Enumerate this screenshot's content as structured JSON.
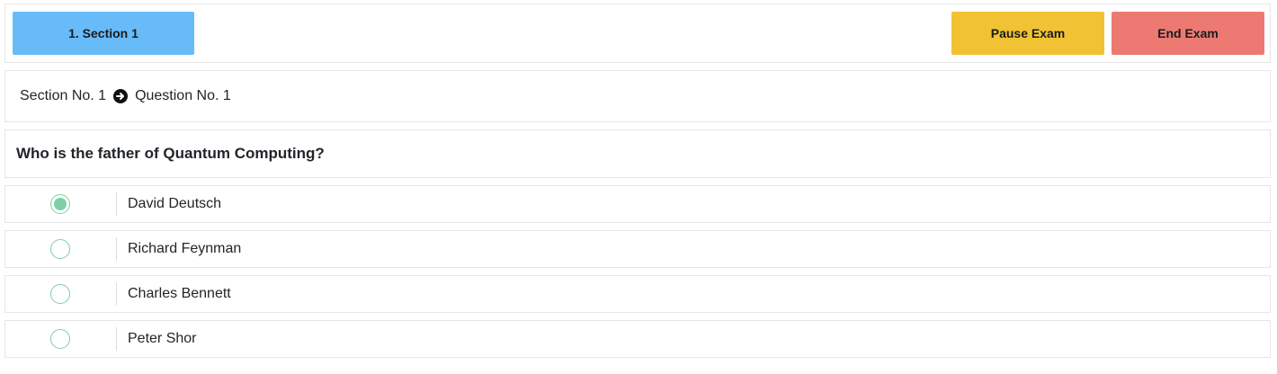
{
  "toolbar": {
    "section_button": "1. Section 1",
    "pause_button": "Pause Exam",
    "end_button": "End Exam",
    "colors": {
      "section": "#67bbf9",
      "pause": "#f1c233",
      "end": "#ec7a73"
    }
  },
  "breadcrumb": {
    "section": "Section No. 1",
    "separator_icon": "arrow-circle-right-icon",
    "question": "Question No. 1"
  },
  "question": {
    "text": "Who is the father of Quantum Computing?"
  },
  "options": [
    {
      "label": "David Deutsch",
      "selected": true
    },
    {
      "label": "Richard Feynman",
      "selected": false
    },
    {
      "label": "Charles Bennett",
      "selected": false
    },
    {
      "label": "Peter Shor",
      "selected": false
    }
  ],
  "accent_color": "#7dcfa6"
}
